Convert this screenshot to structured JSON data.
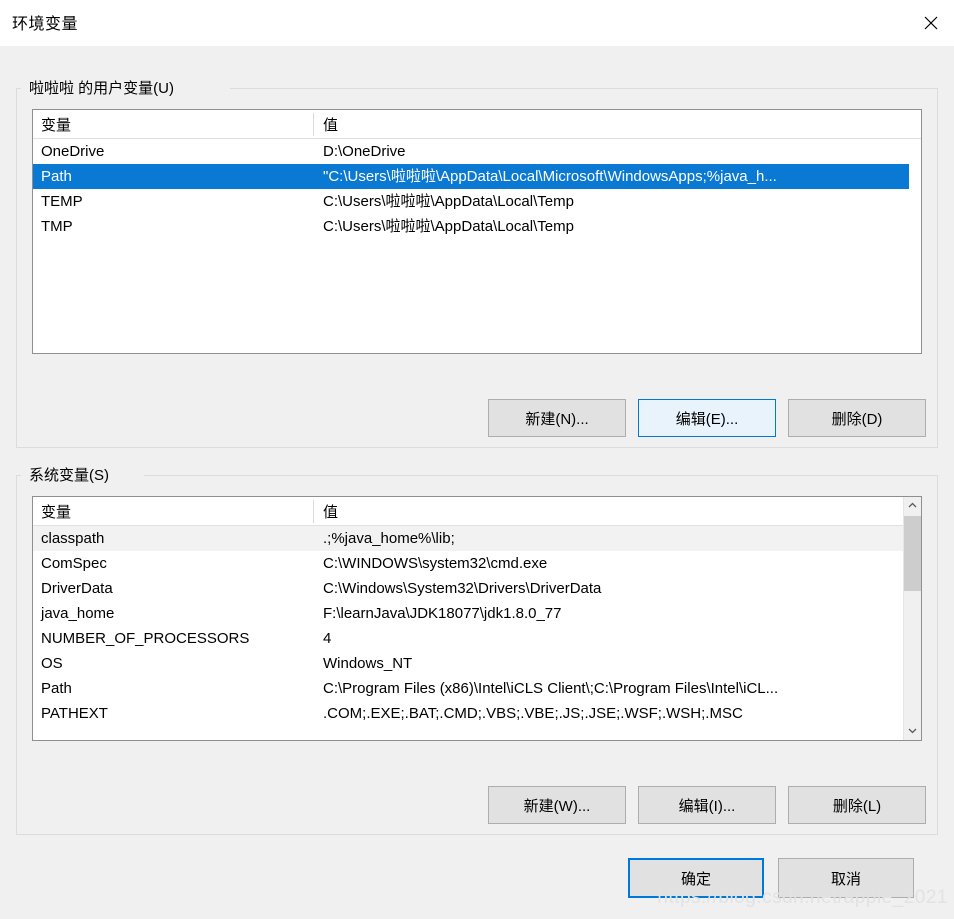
{
  "window": {
    "title": "环境变量",
    "close_icon": "close-icon"
  },
  "user_section": {
    "legend": "啦啦啦 的用户变量(U)",
    "columns": {
      "name": "变量",
      "value": "值"
    },
    "rows": [
      {
        "name": "OneDrive",
        "value": "D:\\OneDrive",
        "state": "normal"
      },
      {
        "name": "Path",
        "value": "\"C:\\Users\\啦啦啦\\AppData\\Local\\Microsoft\\WindowsApps;%java_h...",
        "state": "selected"
      },
      {
        "name": "TEMP",
        "value": "C:\\Users\\啦啦啦\\AppData\\Local\\Temp",
        "state": "normal"
      },
      {
        "name": "TMP",
        "value": "C:\\Users\\啦啦啦\\AppData\\Local\\Temp",
        "state": "normal"
      }
    ],
    "buttons": {
      "new": "新建(N)...",
      "edit": "编辑(E)...",
      "delete": "删除(D)"
    }
  },
  "system_section": {
    "legend": "系统变量(S)",
    "columns": {
      "name": "变量",
      "value": "值"
    },
    "rows": [
      {
        "name": "classpath",
        "value": ".;%java_home%\\lib;",
        "state": "hovered"
      },
      {
        "name": "ComSpec",
        "value": "C:\\WINDOWS\\system32\\cmd.exe",
        "state": "normal"
      },
      {
        "name": "DriverData",
        "value": "C:\\Windows\\System32\\Drivers\\DriverData",
        "state": "normal"
      },
      {
        "name": "java_home",
        "value": "F:\\learnJava\\JDK18077\\jdk1.8.0_77",
        "state": "normal"
      },
      {
        "name": "NUMBER_OF_PROCESSORS",
        "value": "4",
        "state": "normal"
      },
      {
        "name": "OS",
        "value": "Windows_NT",
        "state": "normal"
      },
      {
        "name": "Path",
        "value": "C:\\Program Files (x86)\\Intel\\iCLS Client\\;C:\\Program Files\\Intel\\iCL...",
        "state": "normal"
      },
      {
        "name": "PATHEXT",
        "value": ".COM;.EXE;.BAT;.CMD;.VBS;.VBE;.JS;.JSE;.WSF;.WSH;.MSC",
        "state": "normal"
      }
    ],
    "buttons": {
      "new": "新建(W)...",
      "edit": "编辑(I)...",
      "delete": "删除(L)"
    },
    "scrollbar": {
      "up_icon": "chevron-up-icon",
      "down_icon": "chevron-down-icon"
    }
  },
  "footer": {
    "ok": "确定",
    "cancel": "取消"
  },
  "watermark": "https://blog.csdn.net/apple_2021",
  "colors": {
    "selection_blue": "#0a79d4",
    "focus_blue": "#0078d7",
    "dialog_bg": "#f0f0f0",
    "list_bg": "#ffffff",
    "hover_gray": "#f2f2f2"
  }
}
